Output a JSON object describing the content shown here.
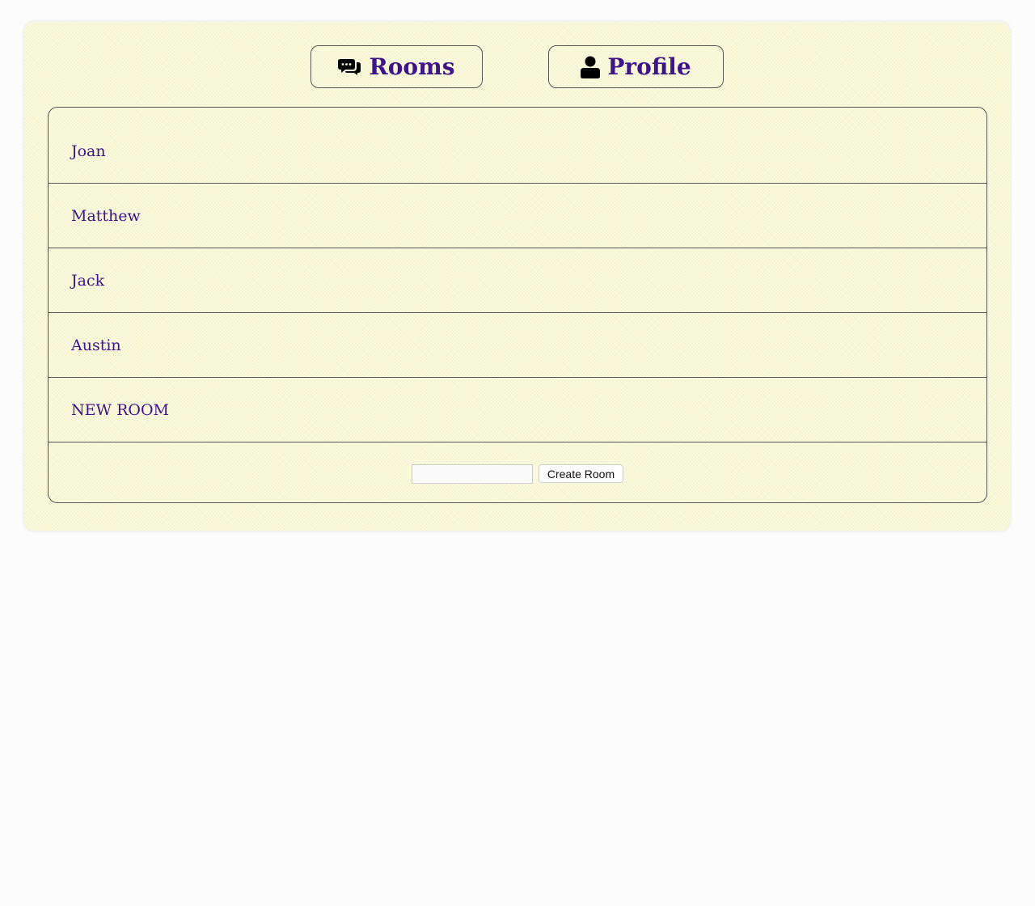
{
  "nav": {
    "rooms_label": "Rooms",
    "rooms_icon": "comments-icon",
    "profile_label": "Profile",
    "profile_icon": "user-icon"
  },
  "rooms": [
    {
      "name": "Joan"
    },
    {
      "name": "Matthew"
    },
    {
      "name": "Jack"
    },
    {
      "name": "Austin"
    },
    {
      "name": "NEW ROOM"
    }
  ],
  "create": {
    "input_value": "",
    "input_placeholder": "",
    "button_label": "Create Room"
  },
  "colors": {
    "accent": "#3e1488",
    "panel_background": "#fbfbdc",
    "page_background": "#fcfcfc",
    "border": "#555555"
  }
}
